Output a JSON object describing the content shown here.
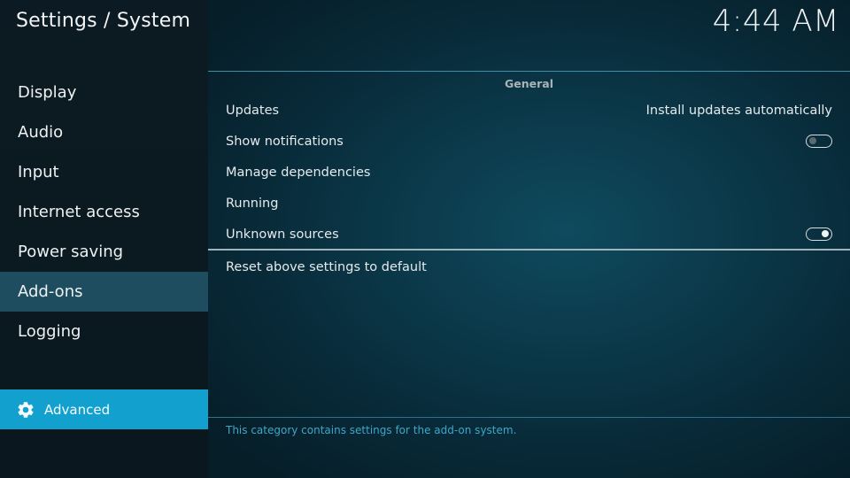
{
  "header": {
    "title": "Settings / System",
    "clock": "4:44 AM"
  },
  "sidebar": {
    "items": [
      {
        "label": "Display"
      },
      {
        "label": "Audio"
      },
      {
        "label": "Input"
      },
      {
        "label": "Internet access"
      },
      {
        "label": "Power saving"
      },
      {
        "label": "Add-ons",
        "selected": true
      },
      {
        "label": "Logging"
      }
    ],
    "level_button": {
      "label": "Advanced",
      "icon": "gear-icon"
    }
  },
  "main": {
    "section_title": "General",
    "settings": [
      {
        "label": "Updates",
        "value": "Install updates automatically"
      },
      {
        "label": "Show notifications",
        "toggle": false
      },
      {
        "label": "Manage dependencies"
      },
      {
        "label": "Running"
      },
      {
        "label": "Unknown sources",
        "toggle": true
      }
    ],
    "reset_label": "Reset above settings to default",
    "description": "This category contains settings for the add-on system."
  },
  "colors": {
    "accent": "#12a0cf",
    "selected_item": "#1f4d60",
    "description_text": "#3ea7c9"
  }
}
